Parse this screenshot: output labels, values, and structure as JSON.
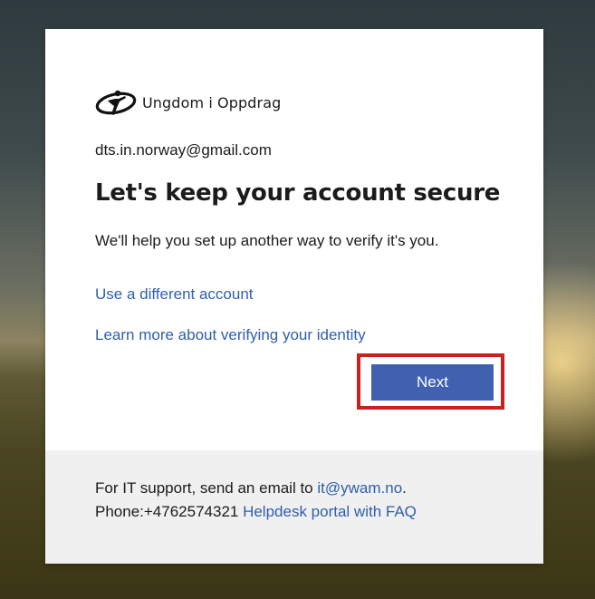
{
  "org": {
    "name": "Ungdom i Oppdrag",
    "logo_icon": "ungdom-i-oppdrag-logo-icon"
  },
  "account": {
    "email": "dts.in.norway@gmail.com"
  },
  "main": {
    "title": "Let's keep your account secure",
    "description": "We'll help you set up another way to verify it's you.",
    "use_different_account_link": "Use a different account",
    "learn_more_link": "Learn more about verifying your identity",
    "next_button": "Next"
  },
  "footer": {
    "support_text": "For IT support, send an email to ",
    "support_email": "it@ywam.no",
    "support_period": ".",
    "phone_text": "Phone:+4762574321 ",
    "helpdesk_link": "Helpdesk portal with FAQ"
  },
  "colors": {
    "link": "#2f5fae",
    "button": "#3f61b0",
    "highlight": "#cc1f1f",
    "footer_bg": "#f0f0f0"
  }
}
